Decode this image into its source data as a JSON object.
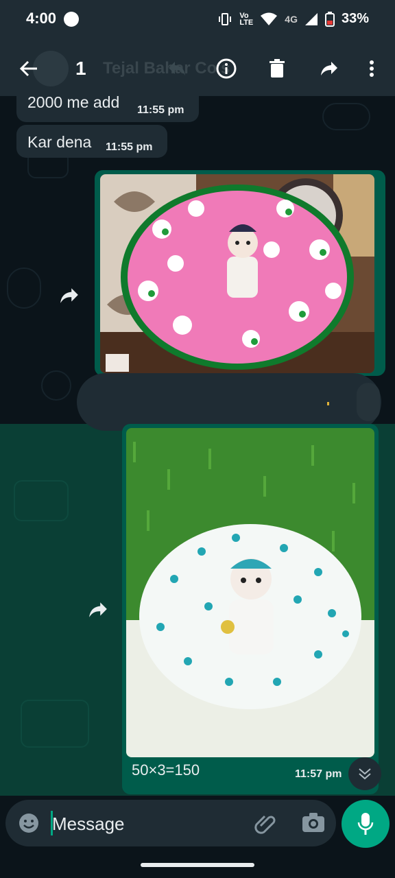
{
  "status_bar": {
    "time": "4:00",
    "network_label": "4G",
    "battery_percent": "33%"
  },
  "app_bar": {
    "selected_count": "1",
    "contact_name": "Tejal Bahar Co's"
  },
  "messages": [
    {
      "text": "2000 me add",
      "time": "11:55 pm"
    },
    {
      "text": "Kar dena",
      "time": "11:55 pm"
    }
  ],
  "image_messages": [
    {
      "description_icon": "doll-pink-dress-photo"
    },
    {
      "caption": "50×3=150",
      "time": "11:57 pm"
    }
  ],
  "input": {
    "placeholder": "Message"
  },
  "colors": {
    "background": "#0b141a",
    "bar": "#1f2c34",
    "outgoing_bubble": "#005c4b",
    "selection": "#0a3f35",
    "accent": "#00a884"
  }
}
